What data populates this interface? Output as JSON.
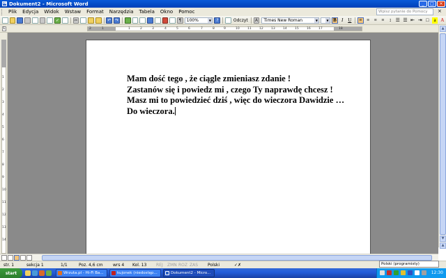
{
  "window": {
    "title": "Dokument2 - Microsoft Word",
    "icon": "word-icon"
  },
  "menu": {
    "items": [
      "Plik",
      "Edycja",
      "Widok",
      "Wstaw",
      "Format",
      "Narzędzia",
      "Tabela",
      "Okno",
      "Pomoc"
    ],
    "help_placeholder": "Wpisz pytanie do Pomocy"
  },
  "toolbar": {
    "zoom": "100%",
    "read_label": "Odczyt",
    "font_name": "Times New Roman",
    "bold": "B",
    "italic": "I",
    "underline": "U"
  },
  "ruler": {
    "ticks": [
      "2",
      "1",
      "1",
      "2",
      "3",
      "4",
      "5",
      "6",
      "7",
      "8",
      "9",
      "10",
      "11",
      "12",
      "13",
      "14",
      "15",
      "16",
      "17",
      "18"
    ],
    "vticks": [
      "1",
      "2",
      "3",
      "4",
      "5",
      "6",
      "7",
      "8",
      "9",
      "10",
      "11",
      "12",
      "13",
      "14"
    ]
  },
  "document": {
    "lines": [
      "Mam dość tego , że ciągle zmieniasz zdanie !",
      "Zastanów się i powiedz mi , czego Ty naprawdę chcesz !",
      "Masz mi to powiedzieć dziś , więc do wieczora Dawidzie …",
      "Do wieczora."
    ]
  },
  "status": {
    "page": "str. 1",
    "section": "sekcja 1",
    "pages": "1/1",
    "position": "Poz. 4,6 cm",
    "line": "wrs 4",
    "column": "Kol. 13",
    "rej": "REJ",
    "zmn": "ZMN",
    "roz": "ROZ",
    "zas": "ZAS",
    "language": "Polski"
  },
  "taskbar": {
    "start": "start",
    "tasks": [
      {
        "label": "Wrzuta.pl - Hi-Fi Ba...",
        "active": false
      },
      {
        "label": "kujonek (niedostęp...",
        "active": false
      },
      {
        "label": "Dokument2 - Micro...",
        "active": true
      }
    ],
    "language_bar": "Polski (programisty)",
    "clock": "12:30"
  },
  "colors": {
    "titlebar": "#0a5ad8",
    "taskbar": "#245edb",
    "workspace": "#8a8a8a"
  }
}
